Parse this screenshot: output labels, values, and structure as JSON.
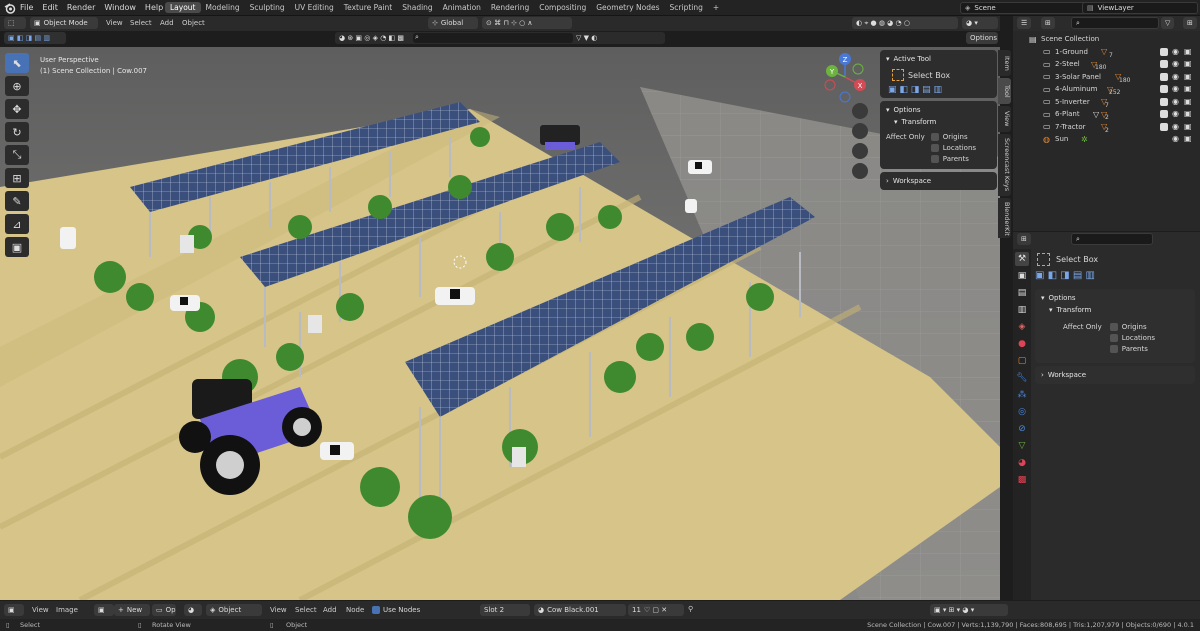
{
  "menu": [
    "File",
    "Edit",
    "Render",
    "Window",
    "Help"
  ],
  "workspace_tabs": [
    "Layout",
    "Modeling",
    "Sculpting",
    "UV Editing",
    "Texture Paint",
    "Shading",
    "Animation",
    "Rendering",
    "Compositing",
    "Geometry Nodes",
    "Scripting"
  ],
  "active_tab": "Layout",
  "add_workspace_icon": "+",
  "scene": "Scene",
  "view_layer": "ViewLayer",
  "viewport_header": {
    "mode": "Object Mode",
    "menus": [
      "View",
      "Select",
      "Add",
      "Object"
    ],
    "orientation": "Global",
    "options_label": "Options"
  },
  "viewport_overlay": {
    "line1": "User Perspective",
    "line2": "(1) Scene Collection | Cow.007"
  },
  "gizmo": {
    "x": "X",
    "y": "Y",
    "z": "Z"
  },
  "npanel": {
    "active_tool_title": "Active Tool",
    "tool_name": "Select Box",
    "options_title": "Options",
    "transform_label": "Transform",
    "affect_only_label": "Affect Only",
    "origins": "Origins",
    "locations": "Locations",
    "parents": "Parents",
    "workspace_title": "Workspace",
    "side_tabs": [
      "Item",
      "Tool",
      "View",
      "Screencast Keys",
      "BlenderKit"
    ]
  },
  "outliner": {
    "root": "Scene Collection",
    "items": [
      {
        "name": "1-Ground",
        "count": "7"
      },
      {
        "name": "2-Steel",
        "count": "180"
      },
      {
        "name": "3-Solar Panel",
        "count": "180"
      },
      {
        "name": "4-Aluminum",
        "count": "252"
      },
      {
        "name": "5-Inverter",
        "count": "7"
      },
      {
        "name": "6-Plant",
        "count": "2"
      },
      {
        "name": "7-Tractor",
        "count": "2"
      },
      {
        "name": "Sun",
        "count": ""
      }
    ]
  },
  "properties": {
    "tool_name": "Select Box",
    "options_title": "Options",
    "transform_label": "Transform",
    "affect_only_label": "Affect Only",
    "origins": "Origins",
    "locations": "Locations",
    "parents": "Parents",
    "workspace_title": "Workspace"
  },
  "shader_header": {
    "view": "View",
    "image": "Image",
    "new": "New",
    "op": "Op",
    "object": "Object",
    "menus": [
      "View",
      "Select",
      "Add",
      "Node"
    ],
    "use_nodes": "Use Nodes",
    "slot": "Slot 2",
    "material": "Cow Black.001",
    "users": "11"
  },
  "status": {
    "left": "Select",
    "middle": "Rotate View",
    "right": "Object",
    "stats": "Scene Collection | Cow.007 | Verts:1,139,790 | Faces:808,695 | Tris:1,207,979 | Objects:0/690 | 4.0.1"
  },
  "colors": {
    "accent": "#4772b3",
    "ground": "#d9c68a",
    "panel": "#3a4d77",
    "tractor": "#6b5cd8",
    "background": "#1d1d1d"
  }
}
